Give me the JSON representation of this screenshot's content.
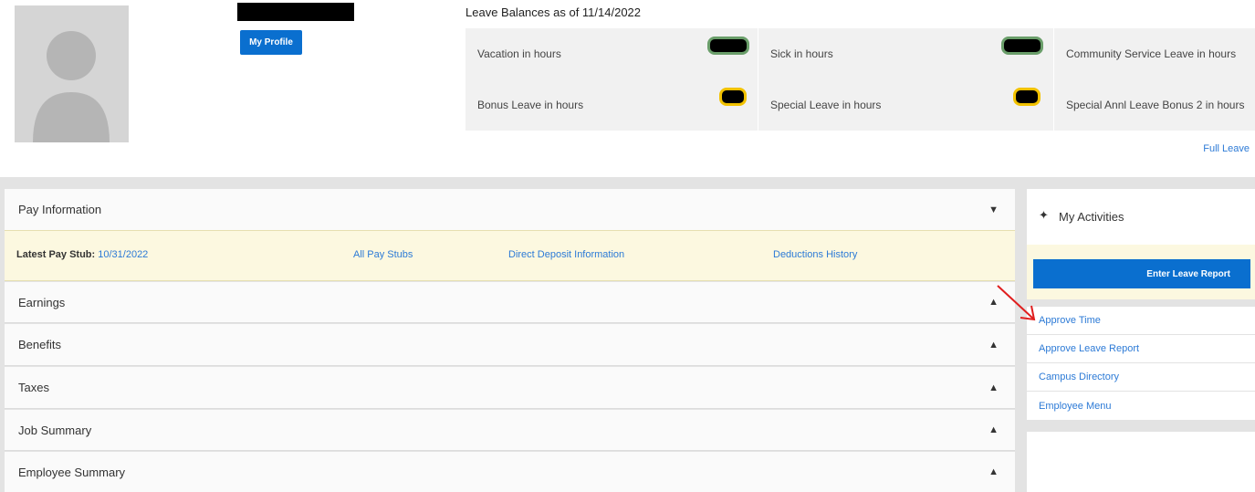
{
  "profile": {
    "button_label": "My Profile"
  },
  "leave": {
    "title": "Leave Balances as of 11/14/2022",
    "items": [
      {
        "label": "Vacation in hours"
      },
      {
        "label": "Sick in hours"
      },
      {
        "label": "Community Service Leave in hours"
      },
      {
        "label": "Bonus Leave in hours"
      },
      {
        "label": "Special Leave in hours"
      },
      {
        "label": "Special Annl Leave Bonus 2 in hours"
      }
    ],
    "full_link": "Full Leave"
  },
  "pay": {
    "title": "Pay Information",
    "latest_label": "Latest Pay Stub:",
    "latest_date": "10/31/2022",
    "links": [
      "All Pay Stubs",
      "Direct Deposit Information",
      "Deductions History"
    ]
  },
  "sections": [
    "Earnings",
    "Benefits",
    "Taxes",
    "Job Summary",
    "Employee Summary"
  ],
  "activities": {
    "title": "My Activities",
    "primary_button": "Enter Leave Report",
    "links": [
      "Approve Time",
      "Approve Leave Report",
      "Campus Directory",
      "Employee Menu"
    ]
  },
  "colors": {
    "primary": "#0a6fcf",
    "link": "#2c7ad6",
    "cream": "#fcf8e0"
  }
}
